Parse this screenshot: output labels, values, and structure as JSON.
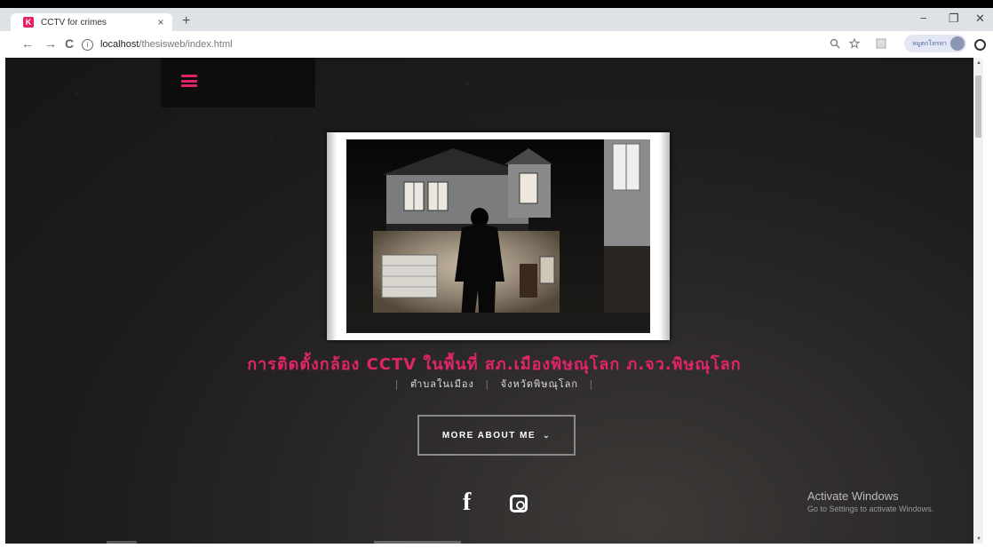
{
  "browser": {
    "tab_title": "CCTV for crimes",
    "favicon_letter": "K",
    "tab_close": "×",
    "new_tab": "+",
    "url_host": "localhost",
    "url_path": "/thesisweb/index.html",
    "profile_label": "หมูตกโทรทา",
    "window_controls": {
      "minimize": "−",
      "maximize": "❐",
      "close": "✕"
    },
    "nav": {
      "back": "←",
      "forward": "→",
      "reload": "C"
    }
  },
  "page": {
    "headline": "การติดตั้งกล้อง CCTV ในพื้นที่ สภ.เมืองพิษณุโลก ภ.จว.พิษณุโลก",
    "sublinks": [
      "ตำบลในเมือง",
      "จังหวัดพิษณุโลก"
    ],
    "separator": "|",
    "more_button": "MORE ABOUT ME",
    "more_chevron": "⌄",
    "social": {
      "facebook": "f"
    }
  },
  "overlay": {
    "activate_title": "Activate Windows",
    "activate_sub": "Go to Settings to activate Windows."
  },
  "colors": {
    "accent": "#e0246a",
    "background": "#1e1d1c"
  },
  "icons": [
    "hamburger-menu-icon",
    "facebook-icon",
    "instagram-icon",
    "zoom-icon",
    "star-icon",
    "extension-icon",
    "avatar-icon",
    "info-icon"
  ]
}
